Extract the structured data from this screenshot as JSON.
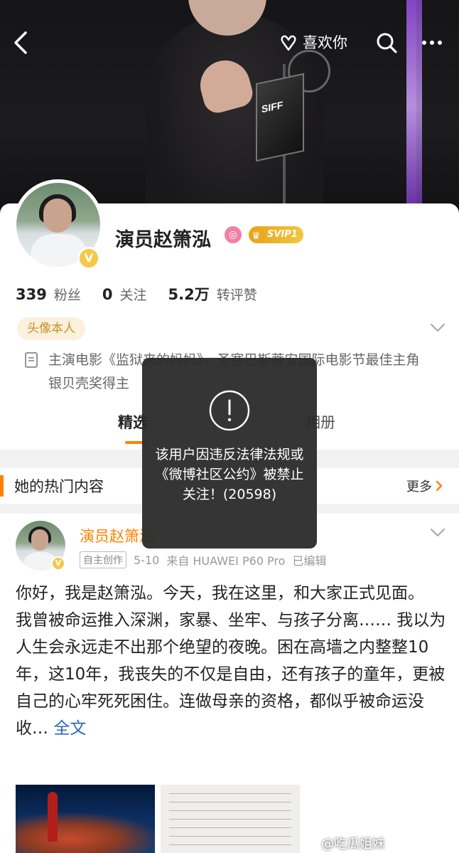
{
  "header": {
    "like_label": "喜欢你",
    "icons": [
      "back-arrow-icon",
      "heart-hands-icon",
      "search-icon",
      "more-icon"
    ]
  },
  "cover": {
    "trophy_text": "SIFF"
  },
  "profile": {
    "name": "演员赵箫泓",
    "svip_label": "SVIP1",
    "verified_mark": "V",
    "stats": [
      {
        "value": "339",
        "label": "粉丝"
      },
      {
        "value": "0",
        "label": "关注"
      },
      {
        "value": "5.2万",
        "label": "转评赞"
      }
    ],
    "tag": "头像本人",
    "bio": "主演电影《监狱来的妈妈》，圣塞巴斯蒂安国际电影节最佳主角银贝壳奖得主",
    "accent_color": "#ff8200"
  },
  "tabs": {
    "active": "精选",
    "album": "相册"
  },
  "hot": {
    "title": "她的热门内容",
    "more_label": "更多"
  },
  "post": {
    "author": "演员赵箫泓",
    "badge": "自主创作",
    "date": "5-10",
    "source": "来自 HUAWEI P60 Pro",
    "edited": "已编辑",
    "text": "你好，我是赵箫泓。今天，我在这里，和大家正式见面。\n我曾被命运推入深渊，家暴、坐牢、与孩子分离…… 我以为人生会永远走不出那个绝望的夜晚。困在高墙之内整整10年，这10年，我丧失的不仅是自由，还有孩子的童年，更被自己的心牢死死困住。连做母亲的资格，都似乎被命运没收… ",
    "full_text_label": "全文",
    "watermark": "@吃瓜姐妹"
  },
  "toast": {
    "icon": "exclamation-circle-icon",
    "message": "该用户因违反法律法规或《微博社区公约》被禁止关注！(20598)"
  }
}
